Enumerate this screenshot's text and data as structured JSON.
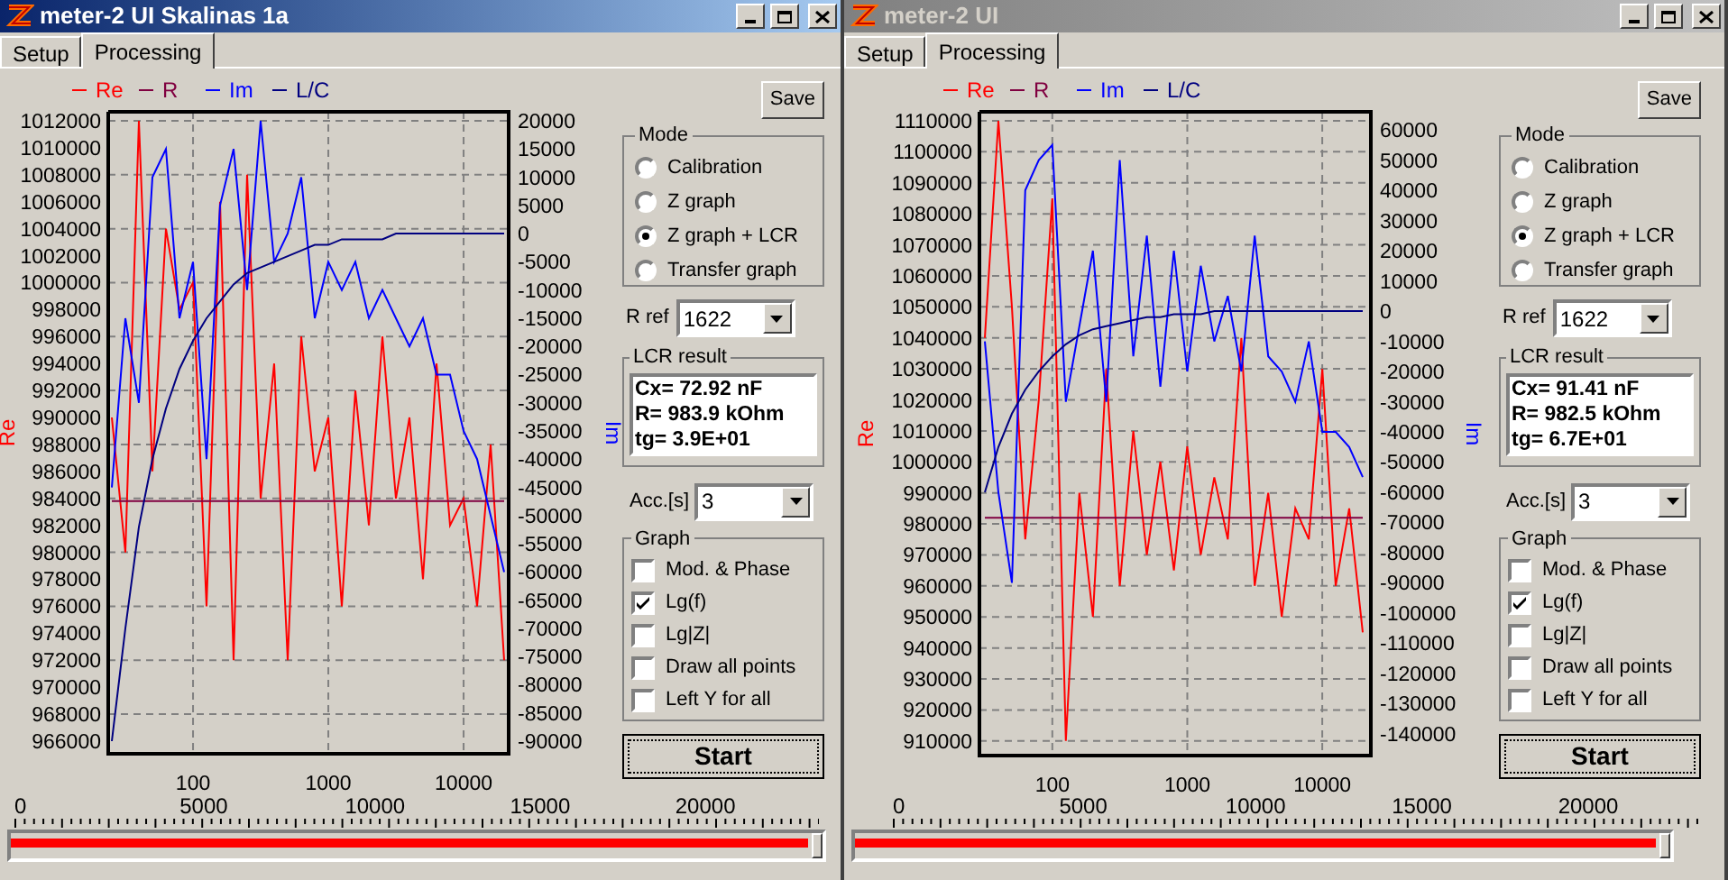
{
  "windows": [
    {
      "title": "meter-2 UI Skalinas 1a",
      "active": true,
      "tabs": [
        {
          "label": "Setup",
          "selected": false
        },
        {
          "label": "Processing",
          "selected": true
        }
      ],
      "chart_data": {
        "type": "line",
        "ylabel": "Re",
        "y2label": "Im",
        "grid": true,
        "legend": "top",
        "categories": [
          null,
          null,
          null,
          null,
          null,
          null,
          "100",
          null,
          null,
          null,
          null,
          null,
          null,
          null,
          null,
          null,
          "1000",
          null,
          null,
          null,
          null,
          null,
          null,
          null,
          null,
          null,
          "10000",
          null,
          null,
          null
        ],
        "ylim": [
          965060,
          1012670
        ],
        "yticks": [
          1012000,
          1010000,
          1008000,
          1006000,
          1004000,
          1002000,
          1000000,
          998000,
          996000,
          994000,
          992000,
          990000,
          988000,
          986000,
          984000,
          982000,
          980000,
          978000,
          976000,
          974000,
          972000,
          970000,
          968000,
          966000
        ],
        "y2lim": [
          -92240,
          21600
        ],
        "y2ticks": [
          20000,
          15000,
          10000,
          5000,
          0,
          -5000,
          -10000,
          -15000,
          -20000,
          -25000,
          -30000,
          -35000,
          -40000,
          -45000,
          -50000,
          -55000,
          -60000,
          -65000,
          -70000,
          -75000,
          -80000,
          -85000,
          -90000
        ],
        "series": [
          {
            "name": "Re",
            "color": "#ff0000",
            "axis": "y",
            "values": [
              990000,
              980000,
              1012000,
              986000,
              1004000,
              998000,
              1000000,
              976000,
              1006000,
              972000,
              1008000,
              984000,
              994000,
              972000,
              996000,
              986000,
              990000,
              976000,
              992000,
              982000,
              996000,
              984000,
              990000,
              978000,
              994000,
              982000,
              984000,
              976000,
              988000,
              972000
            ]
          },
          {
            "name": "R",
            "color": "#800040",
            "axis": "y",
            "values": [
              983800,
              983800,
              983800,
              983800,
              983800,
              983800,
              983800,
              983800,
              983800,
              983800,
              983800,
              983800,
              983800,
              983800,
              983800,
              983800,
              983800,
              983800,
              983800,
              983800,
              983800,
              983800,
              983800,
              983800,
              983800,
              983800,
              983800,
              983800,
              983800,
              983800
            ]
          },
          {
            "name": "Im",
            "color": "#0000ff",
            "axis": "y2",
            "values": [
              -45000,
              -15000,
              -30000,
              10000,
              15000,
              -15000,
              -5000,
              -40000,
              5000,
              15000,
              -10000,
              20000,
              -5000,
              0,
              10000,
              -15000,
              -5000,
              -10000,
              -5000,
              -15000,
              -10000,
              -15000,
              -20000,
              -15000,
              -25000,
              -25000,
              -35000,
              -40000,
              -50000,
              -60000
            ]
          },
          {
            "name": "L/C",
            "color": "#000080",
            "axis": "y2",
            "values": [
              -90000,
              -70000,
              -52000,
              -40000,
              -31000,
              -24000,
              -19000,
              -15000,
              -12000,
              -9000,
              -7000,
              -6000,
              -5000,
              -4000,
              -3000,
              -2000,
              -2000,
              -1000,
              -1000,
              -1000,
              -1000,
              0,
              0,
              0,
              0,
              0,
              0,
              0,
              0,
              0
            ]
          }
        ]
      },
      "save": "Save",
      "mode": {
        "title": "Mode",
        "options": [
          {
            "label": "Calibration",
            "selected": false
          },
          {
            "label": "Z graph",
            "selected": false
          },
          {
            "label": "Z graph + LCR",
            "selected": true
          },
          {
            "label": "Transfer graph",
            "selected": false
          }
        ]
      },
      "r_ref": {
        "label": "R ref",
        "value": "1622"
      },
      "lcr_result": {
        "title": "LCR result",
        "lines": [
          "Cx= 72.92 nF",
          "R= 983.9 kOhm",
          "tg= 3.9E+01"
        ]
      },
      "acc": {
        "label": "Acc.[s]",
        "value": "3"
      },
      "graph": {
        "title": "Graph",
        "options": [
          {
            "label": "Mod. & Phase",
            "checked": false
          },
          {
            "label": "Lg(f)",
            "checked": true
          },
          {
            "label": "Lg|Z|",
            "checked": false
          },
          {
            "label": "Draw all points",
            "checked": false
          },
          {
            "label": "Left Y for all",
            "checked": false
          }
        ]
      },
      "start": "Start",
      "ruler": {
        "labels": [
          "0",
          "5000",
          "10000",
          "15000",
          "20000"
        ],
        "level": 1
      }
    },
    {
      "title": "meter-2 UI",
      "active": false,
      "tabs": [
        {
          "label": "Setup",
          "selected": false
        },
        {
          "label": "Processing",
          "selected": true
        }
      ],
      "chart_data": {
        "type": "line",
        "ylabel": "Re",
        "y2label": "Im",
        "grid": true,
        "legend": "top",
        "categories": [
          null,
          null,
          null,
          null,
          null,
          "100",
          null,
          null,
          null,
          null,
          null,
          null,
          null,
          null,
          null,
          "1000",
          null,
          null,
          null,
          null,
          null,
          null,
          null,
          null,
          null,
          "10000",
          null,
          null,
          null
        ],
        "ylim": [
          905300,
          1112900
        ],
        "yticks": [
          1110000,
          1100000,
          1090000,
          1080000,
          1070000,
          1060000,
          1050000,
          1040000,
          1030000,
          1020000,
          1010000,
          1000000,
          990000,
          980000,
          970000,
          960000,
          950000,
          940000,
          930000,
          920000,
          910000
        ],
        "y2lim": [
          -147200,
          66000
        ],
        "y2ticks": [
          60000,
          50000,
          40000,
          30000,
          20000,
          10000,
          0,
          -10000,
          -20000,
          -30000,
          -40000,
          -50000,
          -60000,
          -70000,
          -80000,
          -90000,
          -100000,
          -110000,
          -120000,
          -130000,
          -140000
        ],
        "series": [
          {
            "name": "Re",
            "color": "#ff0000",
            "axis": "y",
            "values": [
              1040000,
              1110000,
              1050000,
              975000,
              1020000,
              1085000,
              910000,
              990000,
              950000,
              1030000,
              960000,
              1010000,
              970000,
              1000000,
              965000,
              1005000,
              970000,
              995000,
              975000,
              1040000,
              960000,
              990000,
              950000,
              985000,
              975000,
              1030000,
              960000,
              985000,
              945000
            ]
          },
          {
            "name": "R",
            "color": "#800040",
            "axis": "y",
            "values": [
              982000,
              982000,
              982000,
              982000,
              982000,
              982000,
              982000,
              982000,
              982000,
              982000,
              982000,
              982000,
              982000,
              982000,
              982000,
              982000,
              982000,
              982000,
              982000,
              982000,
              982000,
              982000,
              982000,
              982000,
              982000,
              982000,
              982000,
              982000,
              982000
            ]
          },
          {
            "name": "Im",
            "color": "#0000ff",
            "axis": "y2",
            "values": [
              -10000,
              -60000,
              -90000,
              40000,
              50000,
              55000,
              -30000,
              -5000,
              20000,
              -30000,
              50000,
              -15000,
              25000,
              -25000,
              20000,
              -20000,
              15000,
              -10000,
              5000,
              -20000,
              25000,
              -15000,
              -20000,
              -30000,
              -10000,
              -40000,
              -40000,
              -45000,
              -55000
            ]
          },
          {
            "name": "L/C",
            "color": "#000080",
            "axis": "y2",
            "values": [
              -60000,
              -45000,
              -34000,
              -26000,
              -20000,
              -15000,
              -11000,
              -8000,
              -6000,
              -5000,
              -4000,
              -3000,
              -2000,
              -2000,
              -1000,
              -1000,
              -1000,
              0,
              0,
              0,
              0,
              0,
              0,
              0,
              0,
              0,
              0,
              0,
              0
            ]
          }
        ]
      },
      "save": "Save",
      "mode": {
        "title": "Mode",
        "options": [
          {
            "label": "Calibration",
            "selected": false
          },
          {
            "label": "Z graph",
            "selected": false
          },
          {
            "label": "Z graph + LCR",
            "selected": true
          },
          {
            "label": "Transfer graph",
            "selected": false
          }
        ]
      },
      "r_ref": {
        "label": "R ref",
        "value": "1622"
      },
      "lcr_result": {
        "title": "LCR result",
        "lines": [
          "Cx= 91.41 nF",
          "R= 982.5 kOhm",
          "tg= 6.7E+01"
        ]
      },
      "acc": {
        "label": "Acc.[s]",
        "value": "3"
      },
      "graph": {
        "title": "Graph",
        "options": [
          {
            "label": "Mod. & Phase",
            "checked": false
          },
          {
            "label": "Lg(f)",
            "checked": true
          },
          {
            "label": "Lg|Z|",
            "checked": false
          },
          {
            "label": "Draw all points",
            "checked": false
          },
          {
            "label": "Left Y for all",
            "checked": false
          }
        ]
      },
      "start": "Start",
      "ruler": {
        "labels": [
          "0",
          "5000",
          "10000",
          "15000",
          "20000"
        ],
        "level": 1
      }
    }
  ]
}
